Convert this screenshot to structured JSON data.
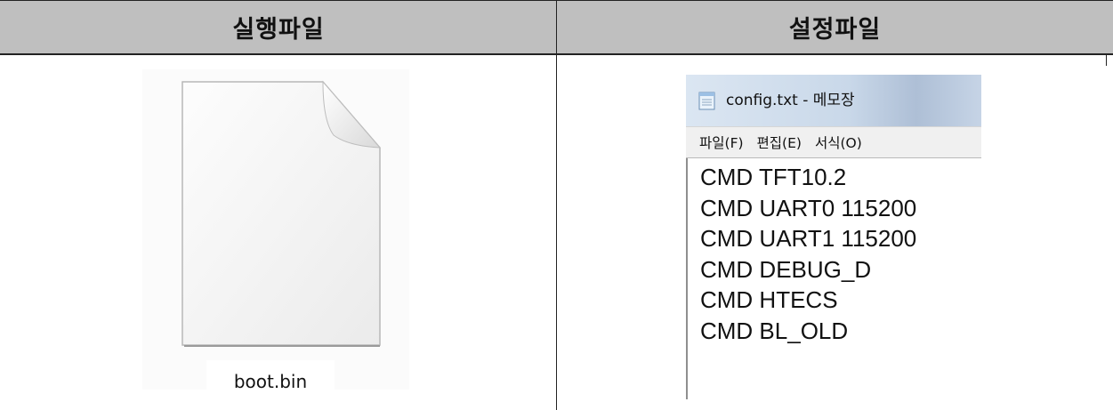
{
  "table": {
    "headers": [
      "실행파일",
      "설정파일"
    ]
  },
  "executable": {
    "file_name": "boot.bin",
    "icon": "file-icon"
  },
  "notepad": {
    "title": "config.txt - 메모장",
    "menu": [
      "파일(F)",
      "편집(E)",
      "서식(O)"
    ],
    "lines": [
      "CMD TFT10.2",
      "CMD UART0 115200",
      "CMD UART1 115200",
      "CMD DEBUG_D",
      "CMD HTECS",
      "CMD BL_OLD"
    ]
  }
}
